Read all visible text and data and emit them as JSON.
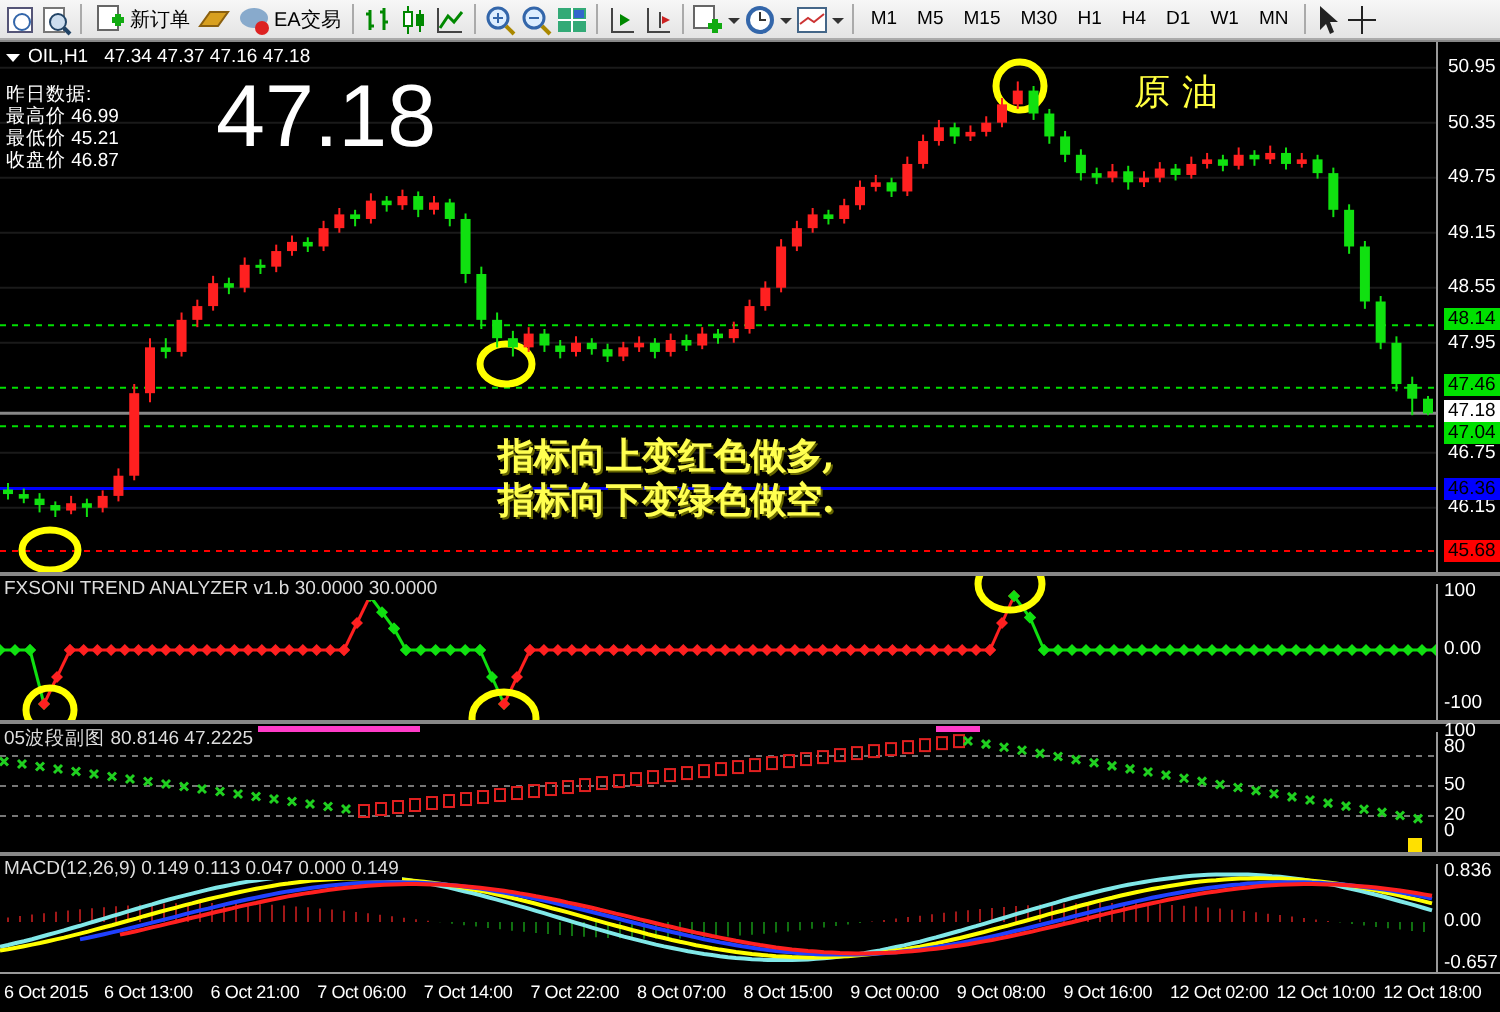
{
  "toolbar": {
    "buttons": [
      {
        "label": "新订单",
        "kind": "order"
      },
      {
        "label": "EA交易",
        "kind": "ea"
      }
    ],
    "timeframes": [
      "M1",
      "M5",
      "M15",
      "M30",
      "H1",
      "H4",
      "D1",
      "W1",
      "MN"
    ]
  },
  "chart": {
    "symbol": "OIL,H1",
    "ohlc": "47.34 47.37 47.16 47.18",
    "current_price": "47.18",
    "yesterday": {
      "title": "昨日数据:",
      "rows": [
        "最高价 46.99",
        "最低价 45.21",
        "收盘价 46.87"
      ]
    },
    "annotation_label": "原油",
    "notes": [
      "指标向上变红色做多,",
      "指标向下变绿色做空."
    ],
    "price_badges": [
      {
        "text": "48.14",
        "color": "#00e000"
      },
      {
        "text": "47.46",
        "color": "#00e000"
      },
      {
        "text": "47.18",
        "color": "#ffffff"
      },
      {
        "text": "47.04",
        "color": "#00e000"
      },
      {
        "text": "46.36",
        "color": "#0000ff"
      },
      {
        "text": "45.68",
        "color": "#ff0000"
      }
    ],
    "chart_data": {
      "type": "candlestick",
      "ylim": [
        45.45,
        51.23
      ],
      "grid": true,
      "yticks": [
        50.95,
        50.35,
        49.75,
        49.15,
        48.55,
        47.95,
        46.75,
        46.15
      ],
      "categories": [
        null,
        null,
        null,
        null,
        null,
        null,
        null,
        null,
        null,
        null,
        null,
        null,
        null,
        null,
        null,
        null,
        null,
        null,
        null,
        null,
        null,
        null,
        null,
        null,
        null,
        null,
        null,
        null,
        null,
        null,
        null,
        null,
        null,
        null,
        null,
        null,
        null,
        null,
        null,
        null,
        null,
        null,
        null,
        null,
        null,
        null,
        null,
        null,
        null,
        null,
        null,
        null,
        null,
        null,
        null,
        null,
        null,
        null,
        null,
        null,
        null,
        null,
        null,
        null,
        null,
        null,
        null,
        null,
        null,
        null,
        null,
        null,
        null,
        null,
        null,
        null,
        null,
        null,
        null,
        null,
        null,
        null,
        null,
        null,
        null,
        null,
        null,
        null,
        null,
        null,
        null
      ],
      "ohlc": [
        [
          46.35,
          46.42,
          46.24,
          46.3
        ],
        [
          46.3,
          46.36,
          46.2,
          46.25
        ],
        [
          46.25,
          46.31,
          46.1,
          46.18
        ],
        [
          46.18,
          46.22,
          46.05,
          46.12
        ],
        [
          46.12,
          46.28,
          46.08,
          46.2
        ],
        [
          46.2,
          46.25,
          46.05,
          46.15
        ],
        [
          46.15,
          46.34,
          46.1,
          46.28
        ],
        [
          46.28,
          46.58,
          46.22,
          46.5
        ],
        [
          46.5,
          47.5,
          46.45,
          47.4
        ],
        [
          47.4,
          48.0,
          47.3,
          47.9
        ],
        [
          47.9,
          48.0,
          47.78,
          47.85
        ],
        [
          47.85,
          48.28,
          47.8,
          48.2
        ],
        [
          48.2,
          48.42,
          48.12,
          48.35
        ],
        [
          48.35,
          48.68,
          48.3,
          48.6
        ],
        [
          48.6,
          48.66,
          48.48,
          48.55
        ],
        [
          48.55,
          48.88,
          48.5,
          48.8
        ],
        [
          48.8,
          48.86,
          48.7,
          48.78
        ],
        [
          48.78,
          49.02,
          48.72,
          48.95
        ],
        [
          48.95,
          49.12,
          48.9,
          49.05
        ],
        [
          49.05,
          49.1,
          48.94,
          49.0
        ],
        [
          49.0,
          49.28,
          48.95,
          49.2
        ],
        [
          49.2,
          49.42,
          49.15,
          49.35
        ],
        [
          49.35,
          49.4,
          49.22,
          49.3
        ],
        [
          49.3,
          49.58,
          49.25,
          49.5
        ],
        [
          49.5,
          49.55,
          49.38,
          49.45
        ],
        [
          49.45,
          49.62,
          49.4,
          49.55
        ],
        [
          49.55,
          49.6,
          49.32,
          49.4
        ],
        [
          49.4,
          49.55,
          49.35,
          49.48
        ],
        [
          49.48,
          49.52,
          49.22,
          49.3
        ],
        [
          49.3,
          49.36,
          48.6,
          48.7
        ],
        [
          48.7,
          48.78,
          48.1,
          48.2
        ],
        [
          48.2,
          48.28,
          47.9,
          48.0
        ],
        [
          48.0,
          48.08,
          47.8,
          47.9
        ],
        [
          47.9,
          48.12,
          47.85,
          48.05
        ],
        [
          48.05,
          48.1,
          47.85,
          47.92
        ],
        [
          47.92,
          47.98,
          47.78,
          47.85
        ],
        [
          47.85,
          48.02,
          47.8,
          47.95
        ],
        [
          47.95,
          48.0,
          47.82,
          47.88
        ],
        [
          47.88,
          47.94,
          47.74,
          47.8
        ],
        [
          47.8,
          47.96,
          47.75,
          47.9
        ],
        [
          47.9,
          48.02,
          47.85,
          47.95
        ],
        [
          47.95,
          48.0,
          47.78,
          47.85
        ],
        [
          47.85,
          48.05,
          47.8,
          47.98
        ],
        [
          47.98,
          48.04,
          47.86,
          47.92
        ],
        [
          47.92,
          48.12,
          47.88,
          48.05
        ],
        [
          48.05,
          48.1,
          47.94,
          48.0
        ],
        [
          48.0,
          48.18,
          47.95,
          48.1
        ],
        [
          48.1,
          48.42,
          48.05,
          48.35
        ],
        [
          48.35,
          48.62,
          48.3,
          48.55
        ],
        [
          48.55,
          49.08,
          48.5,
          49.0
        ],
        [
          49.0,
          49.28,
          48.95,
          49.2
        ],
        [
          49.2,
          49.42,
          49.15,
          49.35
        ],
        [
          49.35,
          49.4,
          49.24,
          49.3
        ],
        [
          49.3,
          49.52,
          49.25,
          49.45
        ],
        [
          49.45,
          49.72,
          49.4,
          49.65
        ],
        [
          49.65,
          49.78,
          49.6,
          49.7
        ],
        [
          49.7,
          49.75,
          49.54,
          49.6
        ],
        [
          49.6,
          49.98,
          49.55,
          49.9
        ],
        [
          49.9,
          50.22,
          49.85,
          50.15
        ],
        [
          50.15,
          50.38,
          50.1,
          50.3
        ],
        [
          50.3,
          50.35,
          50.12,
          50.2
        ],
        [
          50.2,
          50.32,
          50.15,
          50.25
        ],
        [
          50.25,
          50.42,
          50.2,
          50.35
        ],
        [
          50.35,
          50.62,
          50.3,
          50.55
        ],
        [
          50.55,
          50.8,
          50.5,
          50.7
        ],
        [
          50.7,
          50.75,
          50.38,
          50.45
        ],
        [
          50.45,
          50.5,
          50.12,
          50.2
        ],
        [
          50.2,
          50.26,
          49.92,
          50.0
        ],
        [
          50.0,
          50.06,
          49.72,
          49.8
        ],
        [
          49.8,
          49.86,
          49.68,
          49.75
        ],
        [
          49.75,
          49.9,
          49.7,
          49.82
        ],
        [
          49.82,
          49.88,
          49.62,
          49.7
        ],
        [
          49.7,
          49.82,
          49.65,
          49.75
        ],
        [
          49.75,
          49.92,
          49.7,
          49.85
        ],
        [
          49.85,
          49.9,
          49.72,
          49.78
        ],
        [
          49.78,
          49.98,
          49.74,
          49.9
        ],
        [
          49.9,
          50.02,
          49.85,
          49.95
        ],
        [
          49.95,
          50.0,
          49.82,
          49.88
        ],
        [
          49.88,
          50.08,
          49.84,
          50.0
        ],
        [
          50.0,
          50.05,
          49.88,
          49.95
        ],
        [
          49.95,
          50.1,
          49.9,
          50.02
        ],
        [
          50.02,
          50.08,
          49.84,
          49.9
        ],
        [
          49.9,
          50.02,
          49.86,
          49.95
        ],
        [
          49.95,
          50.0,
          49.74,
          49.8
        ],
        [
          49.8,
          49.86,
          49.32,
          49.4
        ],
        [
          49.4,
          49.46,
          48.92,
          49.0
        ],
        [
          49.0,
          49.06,
          48.32,
          48.4
        ],
        [
          48.4,
          48.46,
          47.88,
          47.95
        ],
        [
          47.95,
          48.02,
          47.42,
          47.5
        ],
        [
          47.5,
          47.58,
          47.16,
          47.34
        ],
        [
          47.34,
          47.37,
          47.16,
          47.18
        ]
      ]
    }
  },
  "indicators": [
    {
      "kind": "trend",
      "title": "FXSONI TREND ANALYZER v1.b 30.0000 30.0000",
      "axis": [
        "100",
        "0.00",
        "-100"
      ]
    },
    {
      "kind": "oscillator",
      "title": "05波段副图 80.8146 47.2225",
      "axis": [
        "100",
        "80",
        "50",
        "20",
        "0"
      ]
    },
    {
      "kind": "macd",
      "title": "MACD(12,26,9) 0.149 0.113 0.047 0.000 0.149",
      "axis": [
        "0.836",
        "0.00",
        "-0.657"
      ]
    }
  ],
  "time_axis": [
    "6 Oct 2015",
    "6 Oct 13:00",
    "6 Oct 21:00",
    "7 Oct 06:00",
    "7 Oct 14:00",
    "7 Oct 22:00",
    "8 Oct 07:00",
    "8 Oct 15:00",
    "9 Oct 00:00",
    "9 Oct 08:00",
    "9 Oct 16:00",
    "12 Oct 02:00",
    "12 Oct 10:00",
    "12 Oct 18:00"
  ]
}
